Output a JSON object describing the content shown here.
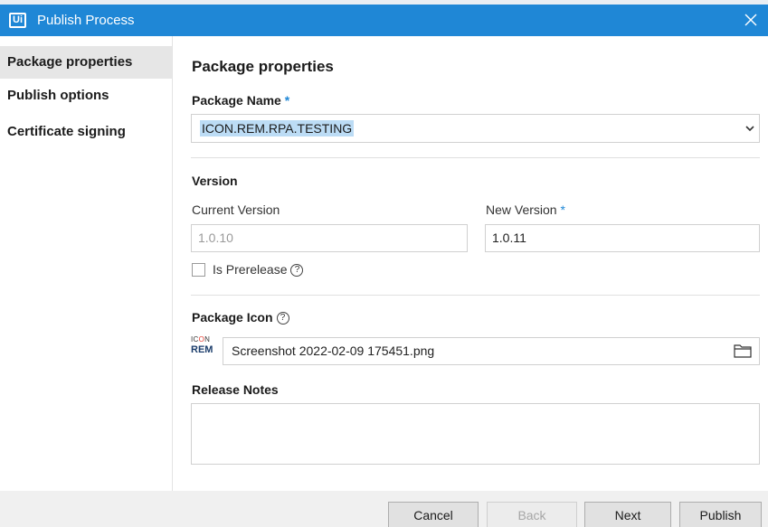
{
  "window": {
    "title": "Publish Process",
    "logo_text": "Ui",
    "titlebar_color": "#1f87d6"
  },
  "sidebar": {
    "items": [
      {
        "label": "Package properties",
        "active": true
      },
      {
        "label": "Publish options",
        "active": false
      },
      {
        "label": "Certificate signing",
        "active": false
      }
    ]
  },
  "main": {
    "section_title": "Package properties",
    "package_name": {
      "label": "Package Name",
      "required_mark": "*",
      "value": "ICON.REM.RPA.TESTING"
    },
    "version": {
      "heading": "Version",
      "current_label": "Current Version",
      "current_value": "1.0.10",
      "new_label": "New Version",
      "new_required_mark": "*",
      "new_value": "1.0.11"
    },
    "prerelease": {
      "label": "Is Prerelease",
      "checked": false,
      "help_glyph": "?"
    },
    "package_icon": {
      "label": "Package Icon",
      "help_glyph": "?",
      "thumb_top": "IC",
      "thumb_o": "O",
      "thumb_n": "N",
      "thumb_bottom": "REM",
      "file_value": "Screenshot 2022-02-09 175451.png",
      "browse_icon": "folder-icon"
    },
    "release_notes": {
      "label": "Release Notes",
      "value": ""
    }
  },
  "footer": {
    "cancel": "Cancel",
    "back": "Back",
    "next": "Next",
    "publish": "Publish"
  }
}
